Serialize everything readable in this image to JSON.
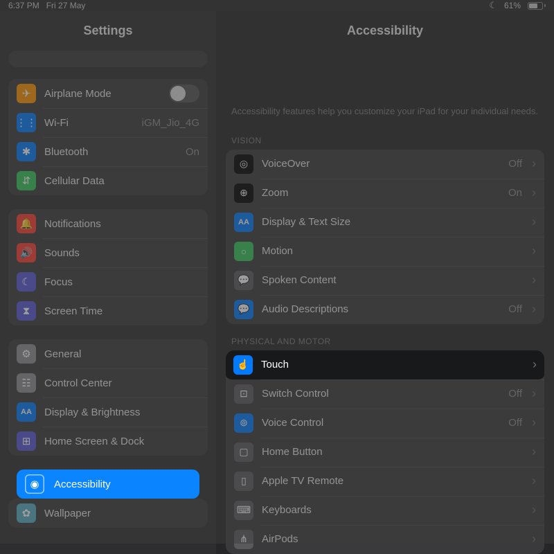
{
  "status": {
    "time": "6:37 PM",
    "date": "Fri 27 May",
    "battery": "61%"
  },
  "sidebar": {
    "title": "Settings",
    "g1": [
      {
        "icon": "airplane",
        "label": "Airplane Mode",
        "kind": "toggle",
        "color": "c-orange"
      },
      {
        "icon": "wifi",
        "label": "Wi-Fi",
        "value": "iGM_Jio_4G",
        "color": "c-blue"
      },
      {
        "icon": "bluetooth",
        "label": "Bluetooth",
        "value": "On",
        "color": "c-blue"
      },
      {
        "icon": "cellular",
        "label": "Cellular Data",
        "color": "c-green"
      }
    ],
    "g2": [
      {
        "icon": "bell",
        "label": "Notifications",
        "color": "c-red"
      },
      {
        "icon": "speaker",
        "label": "Sounds",
        "color": "c-red"
      },
      {
        "icon": "moon",
        "label": "Focus",
        "color": "c-indigo"
      },
      {
        "icon": "hourglass",
        "label": "Screen Time",
        "color": "c-indigo"
      }
    ],
    "g3": [
      {
        "icon": "gear",
        "label": "General",
        "color": "c-gray"
      },
      {
        "icon": "switches",
        "label": "Control Center",
        "color": "c-gray"
      },
      {
        "icon": "aa",
        "label": "Display & Brightness",
        "color": "c-blue"
      },
      {
        "icon": "grid",
        "label": "Home Screen & Dock",
        "color": "c-indigo"
      },
      {
        "icon": "accessibility",
        "label": "Accessibility",
        "color": "c-blue",
        "selected": true
      },
      {
        "icon": "flower",
        "label": "Wallpaper",
        "color": "c-teal"
      }
    ]
  },
  "detail": {
    "title": "Accessibility",
    "description": "Accessibility features help you customize your iPad for your individual needs.",
    "sections": [
      {
        "header": "VISION",
        "items": [
          {
            "icon": "voiceover",
            "label": "VoiceOver",
            "value": "Off",
            "color": "c-black"
          },
          {
            "icon": "zoom",
            "label": "Zoom",
            "value": "On",
            "color": "c-black"
          },
          {
            "icon": "aa",
            "label": "Display & Text Size",
            "color": "c-blue"
          },
          {
            "icon": "motion",
            "label": "Motion",
            "color": "c-green"
          },
          {
            "icon": "bubble",
            "label": "Spoken Content",
            "color": "c-grayd"
          },
          {
            "icon": "bubble2",
            "label": "Audio Descriptions",
            "value": "Off",
            "color": "c-blue"
          }
        ]
      },
      {
        "header": "PHYSICAL AND MOTOR",
        "items": [
          {
            "icon": "touch",
            "label": "Touch",
            "color": "c-blue",
            "selected": true
          },
          {
            "icon": "switch",
            "label": "Switch Control",
            "value": "Off",
            "color": "c-grayd"
          },
          {
            "icon": "voice",
            "label": "Voice Control",
            "value": "Off",
            "color": "c-blue"
          },
          {
            "icon": "homebtn",
            "label": "Home Button",
            "color": "c-grayd"
          },
          {
            "icon": "appletv",
            "label": "Apple TV Remote",
            "color": "c-grayd"
          },
          {
            "icon": "keyboard",
            "label": "Keyboards",
            "color": "c-grayd"
          },
          {
            "icon": "airpods",
            "label": "AirPods",
            "color": "c-grayd"
          }
        ]
      }
    ]
  },
  "icons": {
    "airplane": "✈",
    "wifi": "⋮⋮",
    "bluetooth": "✱",
    "cellular": "⇵",
    "bell": "🔔",
    "speaker": "🔊",
    "moon": "☾",
    "hourglass": "⧗",
    "gear": "⚙",
    "switches": "☷",
    "aa": "AA",
    "grid": "⊞",
    "accessibility": "◉",
    "flower": "✿",
    "voiceover": "◎",
    "zoom": "⊕",
    "motion": "○",
    "bubble": "💬",
    "bubble2": "💬",
    "touch": "☝",
    "switch": "⊡",
    "voice": "⊚",
    "homebtn": "▢",
    "appletv": "▯",
    "keyboard": "⌨",
    "airpods": "⋔"
  }
}
